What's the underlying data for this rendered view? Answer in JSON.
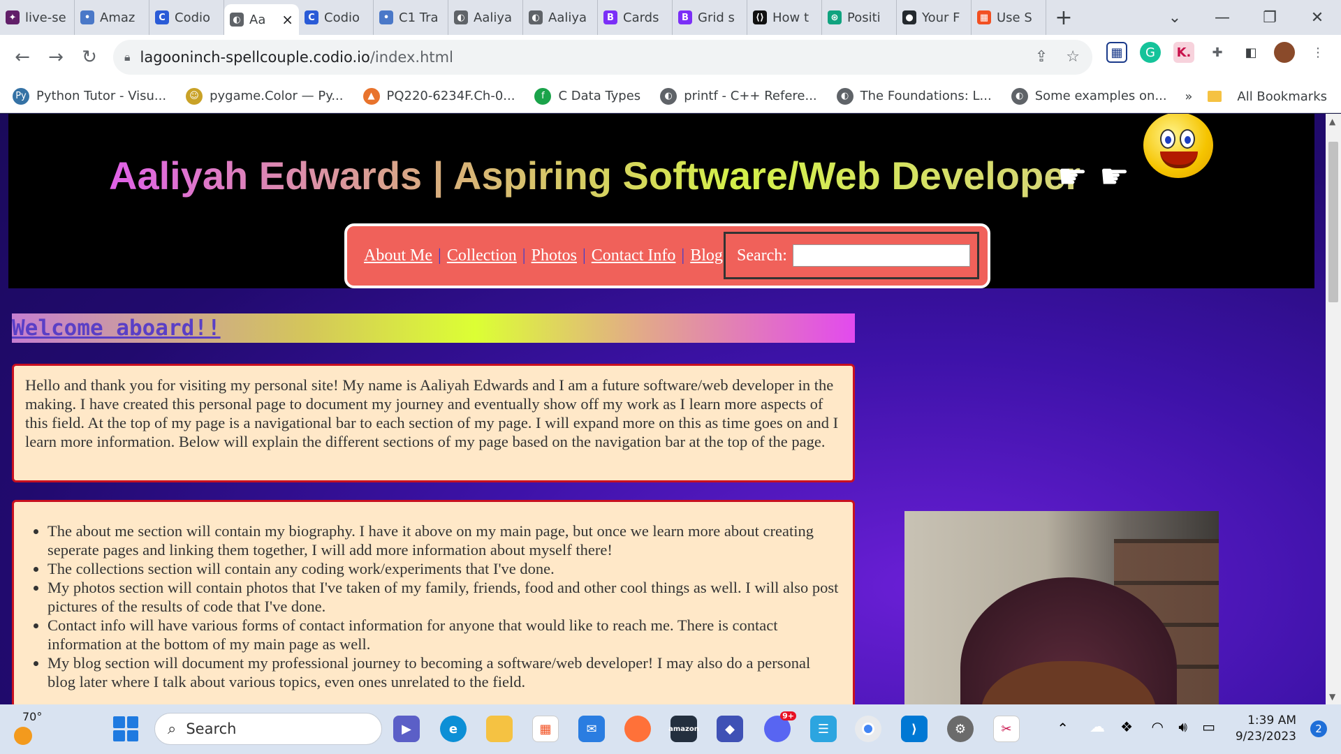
{
  "browser": {
    "tabs": [
      {
        "title": "live-se",
        "icon": "slack-icon",
        "color": "#611f69"
      },
      {
        "title": "Amaz",
        "icon": "dots-icon",
        "color": "#4a78c8"
      },
      {
        "title": "Codio",
        "icon": "codio-icon",
        "color": "#2a5bd7"
      },
      {
        "title": "Aa",
        "icon": "globe-icon",
        "color": "#5f6368",
        "active": true
      },
      {
        "title": "Codio",
        "icon": "codio-icon",
        "color": "#2a5bd7"
      },
      {
        "title": "C1 Tra",
        "icon": "dots-icon",
        "color": "#4a78c8"
      },
      {
        "title": "Aaliya",
        "icon": "globe-icon",
        "color": "#5f6368"
      },
      {
        "title": "Aaliya",
        "icon": "globe-icon",
        "color": "#5f6368"
      },
      {
        "title": "Cards",
        "icon": "bootstrap-icon",
        "color": "#7b2ff7"
      },
      {
        "title": "Grid s",
        "icon": "bootstrap-icon",
        "color": "#7b2ff7"
      },
      {
        "title": "How t",
        "icon": "w3-icon",
        "color": "#111111"
      },
      {
        "title": "Positi",
        "icon": "chatgpt-icon",
        "color": "#10a37f"
      },
      {
        "title": "Your F",
        "icon": "github-icon",
        "color": "#24292e"
      },
      {
        "title": "Use S",
        "icon": "microsoft-icon",
        "color": "#f25022"
      }
    ],
    "tab_glyphs": [
      "✦",
      "•",
      "C",
      "◐",
      "C",
      "•",
      "◐",
      "◐",
      "B",
      "B",
      "⟨⟩",
      "⊛",
      "●",
      "▦"
    ],
    "url_host": "lagooninch-spellcouple.codio.io",
    "url_path": "/index.html",
    "bookmarks": [
      {
        "label": "Python Tutor - Visu...",
        "color": "#3572a5",
        "glyph": "Py"
      },
      {
        "label": "pygame.Color — Py...",
        "color": "#c9a227",
        "glyph": "☺"
      },
      {
        "label": "PQ220-6234F.Ch-0...",
        "color": "#e8732c",
        "glyph": "▲"
      },
      {
        "label": "C Data Types",
        "color": "#1aa34a",
        "glyph": "f"
      },
      {
        "label": "printf - C++ Refere...",
        "color": "#5f6368",
        "glyph": "◐"
      },
      {
        "label": "The Foundations: L...",
        "color": "#5f6368",
        "glyph": "◐"
      },
      {
        "label": "Some examples on...",
        "color": "#5f6368",
        "glyph": "◐"
      }
    ],
    "bookmarks_overflow": "»",
    "all_bookmarks": "All Bookmarks"
  },
  "page": {
    "site_title": "Aaliyah Edwards | Aspiring Software/Web Developer",
    "nav": [
      "About Me",
      "Collection",
      "Photos",
      "Contact Info",
      "Blog"
    ],
    "nav_separator": "|",
    "search_label": "Search:",
    "welcome_heading": "Welcome aboard!!",
    "intro_text": "Hello and thank you for visiting my personal site! My name is Aaliyah Edwards and I am a future software/web developer in the making. I have created this personal page to document my journey and eventually show off my work as I learn more aspects of this field. At the top of my page is a navigational bar to each section of my page. I will expand more on this as time goes on and I learn more information. Below will explain the different sections of my page based on the navigation bar at the top of the page.",
    "sections": [
      "The about me section will contain my biography. I have it above on my main page, but once we learn more about creating seperate pages and linking them together, I will add more information about myself there!",
      "The collections section will contain any coding work/experiments that I've done.",
      "My photos section will contain photos that I've taken of my family, friends, food and other cool things as well. I will also post pictures of the results of code that I've done.",
      "Contact info will have various forms of contact information for anyone that would like to reach me. There is contact information at the bottom of my main page as well.",
      "My blog section will document my professional journey to becoming a software/web developer! I may also do a personal blog later where I talk about various topics, even ones unrelated to the field."
    ]
  },
  "taskbar": {
    "temperature": "70°",
    "search_placeholder": "Search",
    "discord_badge": "9+",
    "time": "1:39 AM",
    "date": "9/23/2023",
    "notification_count": "2"
  }
}
